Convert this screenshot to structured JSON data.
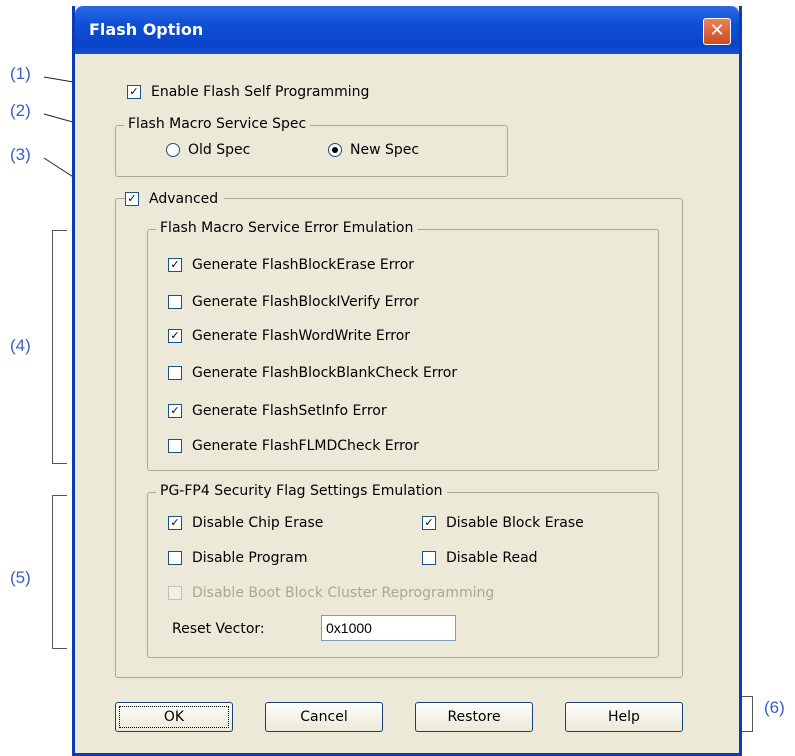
{
  "dialog": {
    "title": "Flash Option",
    "close_glyph": "✕",
    "enable_self_programming": {
      "label": "Enable Flash Self Programming",
      "checked": true
    },
    "service_spec": {
      "legend": "Flash Macro Service Spec",
      "options": [
        {
          "label": "Old Spec",
          "selected": false
        },
        {
          "label": "New Spec",
          "selected": true
        }
      ]
    },
    "advanced": {
      "label": "Advanced",
      "checked": true
    },
    "error_emulation": {
      "legend": "Flash Macro Service Error Emulation",
      "items": [
        {
          "label": "Generate FlashBlockErase Error",
          "checked": true
        },
        {
          "label": "Generate FlashBlockIVerify Error",
          "checked": false
        },
        {
          "label": "Generate FlashWordWrite Error",
          "checked": true
        },
        {
          "label": "Generate FlashBlockBlankCheck Error",
          "checked": false
        },
        {
          "label": "Generate FlashSetInfo Error",
          "checked": true
        },
        {
          "label": "Generate FlashFLMDCheck Error",
          "checked": false
        }
      ]
    },
    "security_flags": {
      "legend": "PG-FP4 Security Flag Settings Emulation",
      "disable_chip_erase": {
        "label": "Disable Chip Erase",
        "checked": true
      },
      "disable_block_erase": {
        "label": "Disable Block Erase",
        "checked": true
      },
      "disable_program": {
        "label": "Disable Program",
        "checked": false
      },
      "disable_read": {
        "label": "Disable Read",
        "checked": false
      },
      "disable_boot_block": {
        "label": "Disable Boot Block Cluster Reprogramming",
        "checked": false,
        "enabled": false
      },
      "reset_vector_label": "Reset Vector:",
      "reset_vector_value": "0x1000"
    },
    "buttons": {
      "ok": "OK",
      "cancel": "Cancel",
      "restore": "Restore",
      "help": "Help"
    }
  },
  "annotations": {
    "a1": "(1)",
    "a2": "(2)",
    "a3": "(3)",
    "a4": "(4)",
    "a5": "(5)",
    "a6": "(6)"
  },
  "colors": {
    "annotation": "#3a5fc8",
    "titlebar": "#0a44c8",
    "close": "#cf4a22"
  }
}
